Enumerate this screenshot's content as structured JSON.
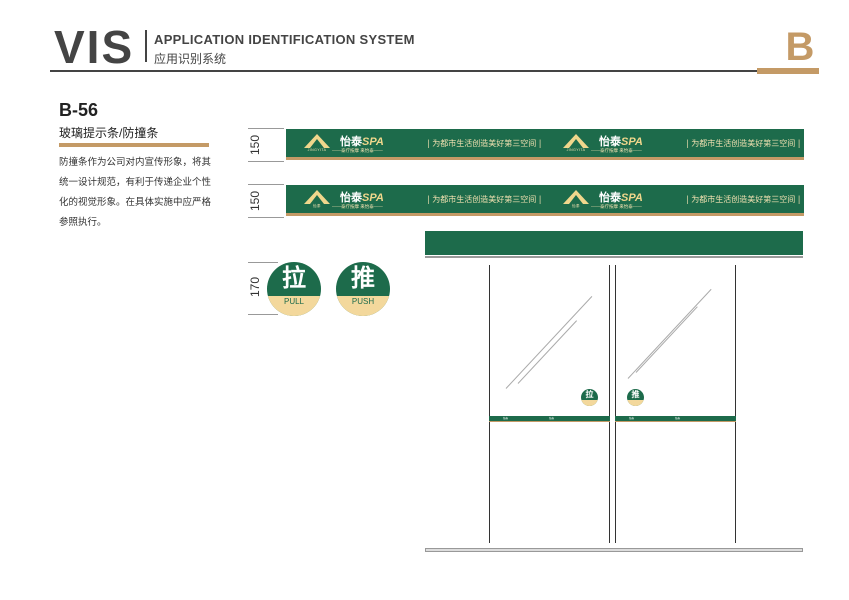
{
  "header": {
    "logo": "VIS",
    "title_en": "APPLICATION IDENTIFICATION SYSTEM",
    "title_cn": "应用识别系统",
    "section_letter": "B"
  },
  "page": {
    "code": "B-56",
    "subtitle": "玻璃提示条/防撞条",
    "description": "防撞条作为公司对内宣传形象，将其统一设计规范，有利于传递企业个性化的视觉形象。在具体实施中应严格参照执行。"
  },
  "dimensions": {
    "strip1_height": "150",
    "strip2_height": "150",
    "circle_height": "170"
  },
  "strip": {
    "logo_en": "JINGYITA",
    "logo_cn": "怡泰",
    "brand_cn": "怡泰",
    "brand_spa": "SPA",
    "tagline": "——泰疗按摩 来怡泰——",
    "slogan": "| 为都市生活创造美好第三空间 |"
  },
  "signs": {
    "pull_cn": "拉",
    "pull_en": "PULL",
    "push_cn": "推",
    "push_en": "PUSH"
  },
  "colors": {
    "brand_green": "#1d6b4b",
    "gold": "#c49a66",
    "cream": "#f3d89c"
  }
}
